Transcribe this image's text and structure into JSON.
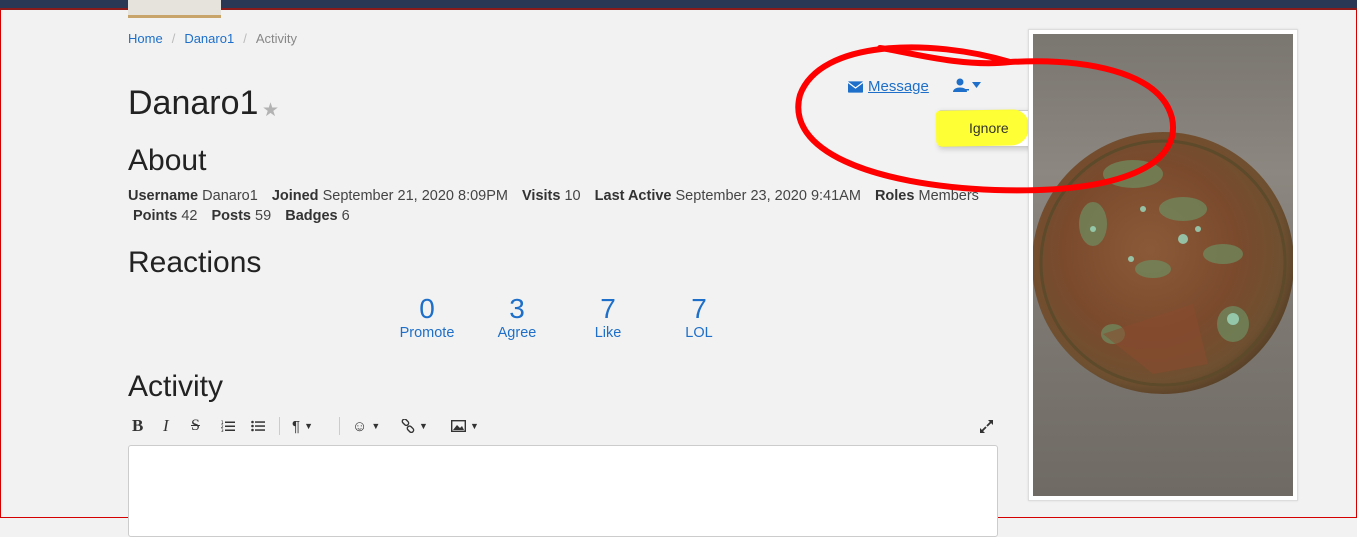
{
  "breadcrumb": {
    "home": "Home",
    "user": "Danaro1",
    "current": "Activity"
  },
  "profile": {
    "name": "Danaro1"
  },
  "actions": {
    "message_label": "Message",
    "menu": {
      "ignore_label": "Ignore"
    }
  },
  "about": {
    "heading": "About",
    "fields": [
      {
        "label": "Username",
        "value": "Danaro1"
      },
      {
        "label": "Joined",
        "value": "September 21, 2020 8:09PM"
      },
      {
        "label": "Visits",
        "value": "10"
      },
      {
        "label": "Last Active",
        "value": "September 23, 2020 9:41AM"
      },
      {
        "label": "Roles",
        "value": "Members"
      },
      {
        "label": "Points",
        "value": "42"
      },
      {
        "label": "Posts",
        "value": "59"
      },
      {
        "label": "Badges",
        "value": "6"
      }
    ]
  },
  "reactions": {
    "heading": "Reactions",
    "items": [
      {
        "count": "0",
        "label": "Promote"
      },
      {
        "count": "3",
        "label": "Agree"
      },
      {
        "count": "7",
        "label": "Like"
      },
      {
        "count": "7",
        "label": "LOL"
      }
    ]
  },
  "activity": {
    "heading": "Activity",
    "toolbar": [
      "bold",
      "italic",
      "strikethrough",
      "ordered-list",
      "bullet-list",
      "paragraph-format",
      "emoji",
      "link",
      "image",
      "fullscreen"
    ]
  },
  "colors": {
    "link": "#1d6fc9",
    "annotation_red": "#ff0000",
    "highlight_yellow": "#ffff2a"
  }
}
